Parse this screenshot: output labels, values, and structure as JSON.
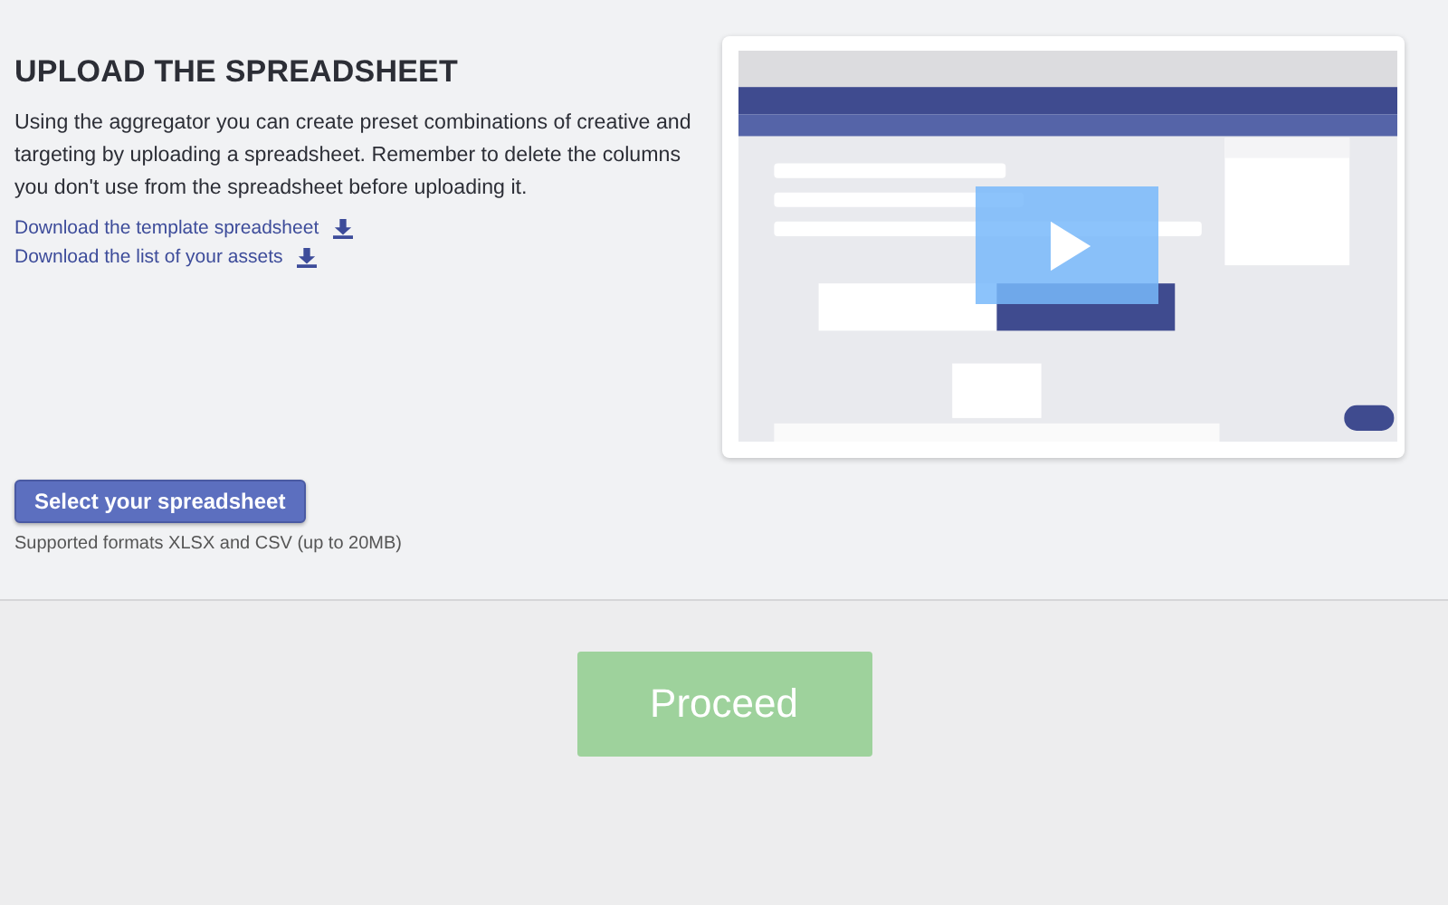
{
  "heading": "UPLOAD THE SPREADSHEET",
  "description": "Using the aggregator you can create preset combinations of creative and targeting by uploading a spreadsheet. Remember to delete the columns you don't use from the spreadsheet before uploading it.",
  "downloads": [
    {
      "label": "Download the template spreadsheet"
    },
    {
      "label": "Download the list of your assets"
    }
  ],
  "select_button": "Select your spreadsheet",
  "formats_note": "Supported formats XLSX and CSV (up to 20MB)",
  "proceed_button": {
    "label": "Proceed",
    "disabled": true
  }
}
